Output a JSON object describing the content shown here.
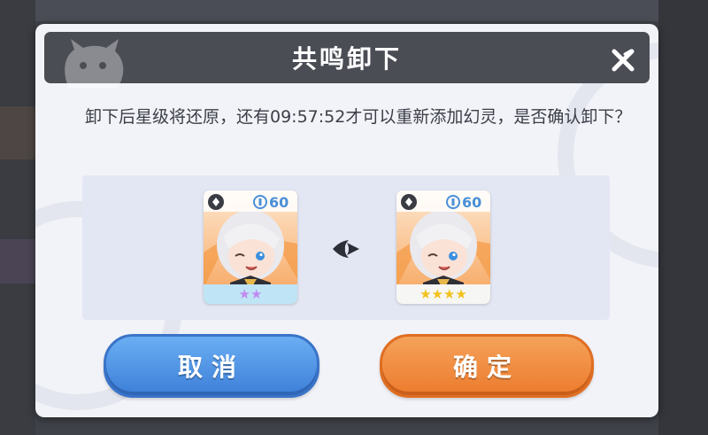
{
  "dialog": {
    "title": "共鸣卸下",
    "message": "卸下后星级将还原，还有09:57:52才可以重新添加幻灵，是否确认卸下？",
    "close_icon": "close-icon"
  },
  "cards": {
    "before": {
      "level": "60",
      "stars": "★★",
      "star_color": "#c18af0",
      "footer_color": "#bfe4f6"
    },
    "after": {
      "level": "60",
      "stars": "★★★★",
      "star_color": "#f2c21c",
      "footer_color": "#f6f6f4"
    }
  },
  "buttons": {
    "cancel_label": "取消",
    "confirm_label": "确定"
  },
  "colors": {
    "cancel": "#4b8fe3",
    "confirm": "#f08a3a",
    "titlebar": "#4b4d55"
  }
}
